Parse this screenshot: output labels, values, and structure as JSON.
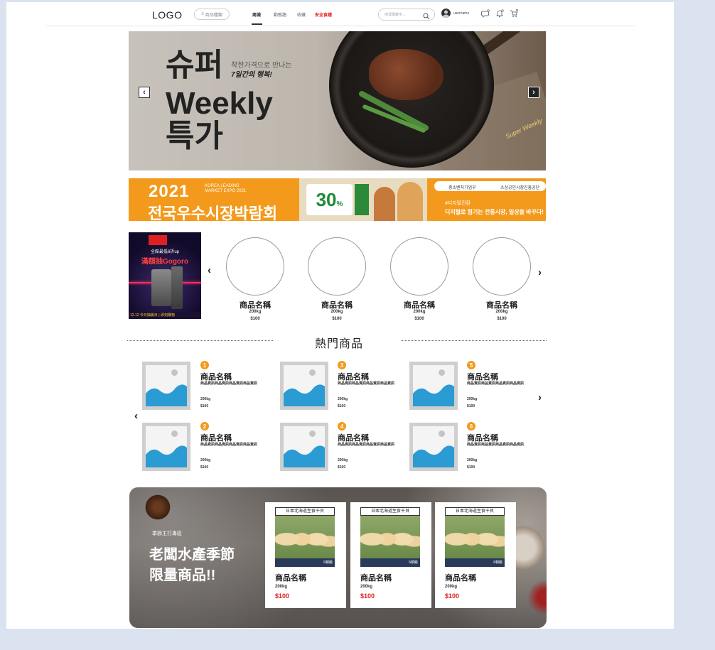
{
  "nav": {
    "logo": "LOGO",
    "category_button": "商品種類",
    "links": [
      {
        "label": "商城",
        "active": true
      },
      {
        "label": "動態牆"
      },
      {
        "label": "收藏"
      },
      {
        "label": "安全食譜",
        "highlight": true
      }
    ],
    "search_placeholder": "搜尋關鍵字...",
    "username": "username",
    "icons": [
      "search-icon",
      "user-avatar",
      "chat-icon",
      "notification-icon",
      "cart-icon"
    ]
  },
  "hero": {
    "title_line1": "슈퍼",
    "title_line2": "Weekly",
    "title_line3": "특가",
    "sub_line1": "착한가격으로 만나는",
    "sub_line2": "7일간의 행복!",
    "signature": "Super Weekly",
    "prev": "‹",
    "next": "›"
  },
  "expo": {
    "year": "2021",
    "en_line1": "KOREA LEADING",
    "en_line2": "MARKET EXPO 2021",
    "ko_title": "전국우수시장박람회",
    "discount": "30",
    "discount_unit": "%",
    "org1": "중소벤처기업부",
    "org2": "소상공인시장진흥공단",
    "tagline1": "#디지털전환",
    "tagline2": "디지털로 힘기는 전통시장, 일상을 바꾸다!"
  },
  "promo": {
    "line1": "全館最低6折up",
    "line2": "滿額抽Gogoro",
    "date": "12.12 今日抽獎日 | 即刻購物"
  },
  "circles": {
    "prev": "‹",
    "next": "›",
    "items": [
      {
        "name": "商品名稱",
        "weight": "200kg",
        "price": "$100"
      },
      {
        "name": "商品名稱",
        "weight": "200kg",
        "price": "$100"
      },
      {
        "name": "商品名稱",
        "weight": "200kg",
        "price": "$100"
      },
      {
        "name": "商品名稱",
        "weight": "200kg",
        "price": "$100"
      }
    ]
  },
  "hot": {
    "title": "熱門商品",
    "prev": "‹",
    "next": "›",
    "items": [
      {
        "rank": "1",
        "name": "商品名稱",
        "desc": "商品資訊商品資訊商品資訊商品資訊",
        "weight": "200kg",
        "price": "$100"
      },
      {
        "rank": "3",
        "name": "商品名稱",
        "desc": "商品資訊商品資訊商品資訊商品資訊",
        "weight": "200kg",
        "price": "$100"
      },
      {
        "rank": "5",
        "name": "商品名稱",
        "desc": "商品資訊商品資訊商品資訊商品資訊",
        "weight": "200kg",
        "price": "$100"
      },
      {
        "rank": "2",
        "name": "商品名稱",
        "desc": "商品資訊商品資訊商品資訊商品資訊",
        "weight": "200kg",
        "price": "$100"
      },
      {
        "rank": "4",
        "name": "商品名稱",
        "desc": "商品資訊商品資訊商品資訊商品資訊",
        "weight": "200kg",
        "price": "$100"
      },
      {
        "rank": "6",
        "name": "商品名稱",
        "desc": "商品資訊商品資訊商品資訊商品資訊",
        "weight": "200kg",
        "price": "$100"
      }
    ]
  },
  "season": {
    "label": "季節主打專區",
    "title_line1": "老闆水產季節",
    "title_line2": "限量商品!!",
    "cards": [
      {
        "banner": "日本北海道生食干貝",
        "tag": "6頓級",
        "name": "商品名稱",
        "weight": "200kg",
        "price": "$100"
      },
      {
        "banner": "日本北海道生食干貝",
        "tag": "6頓級",
        "name": "商品名稱",
        "weight": "200kg",
        "price": "$100"
      },
      {
        "banner": "日本北海道生食干貝",
        "tag": "6頓級",
        "name": "商品名稱",
        "weight": "200kg",
        "price": "$100"
      }
    ]
  },
  "colors": {
    "accent_orange": "#f39a1c",
    "price_red": "#e02020",
    "page_bg": "#dbe3f0"
  }
}
